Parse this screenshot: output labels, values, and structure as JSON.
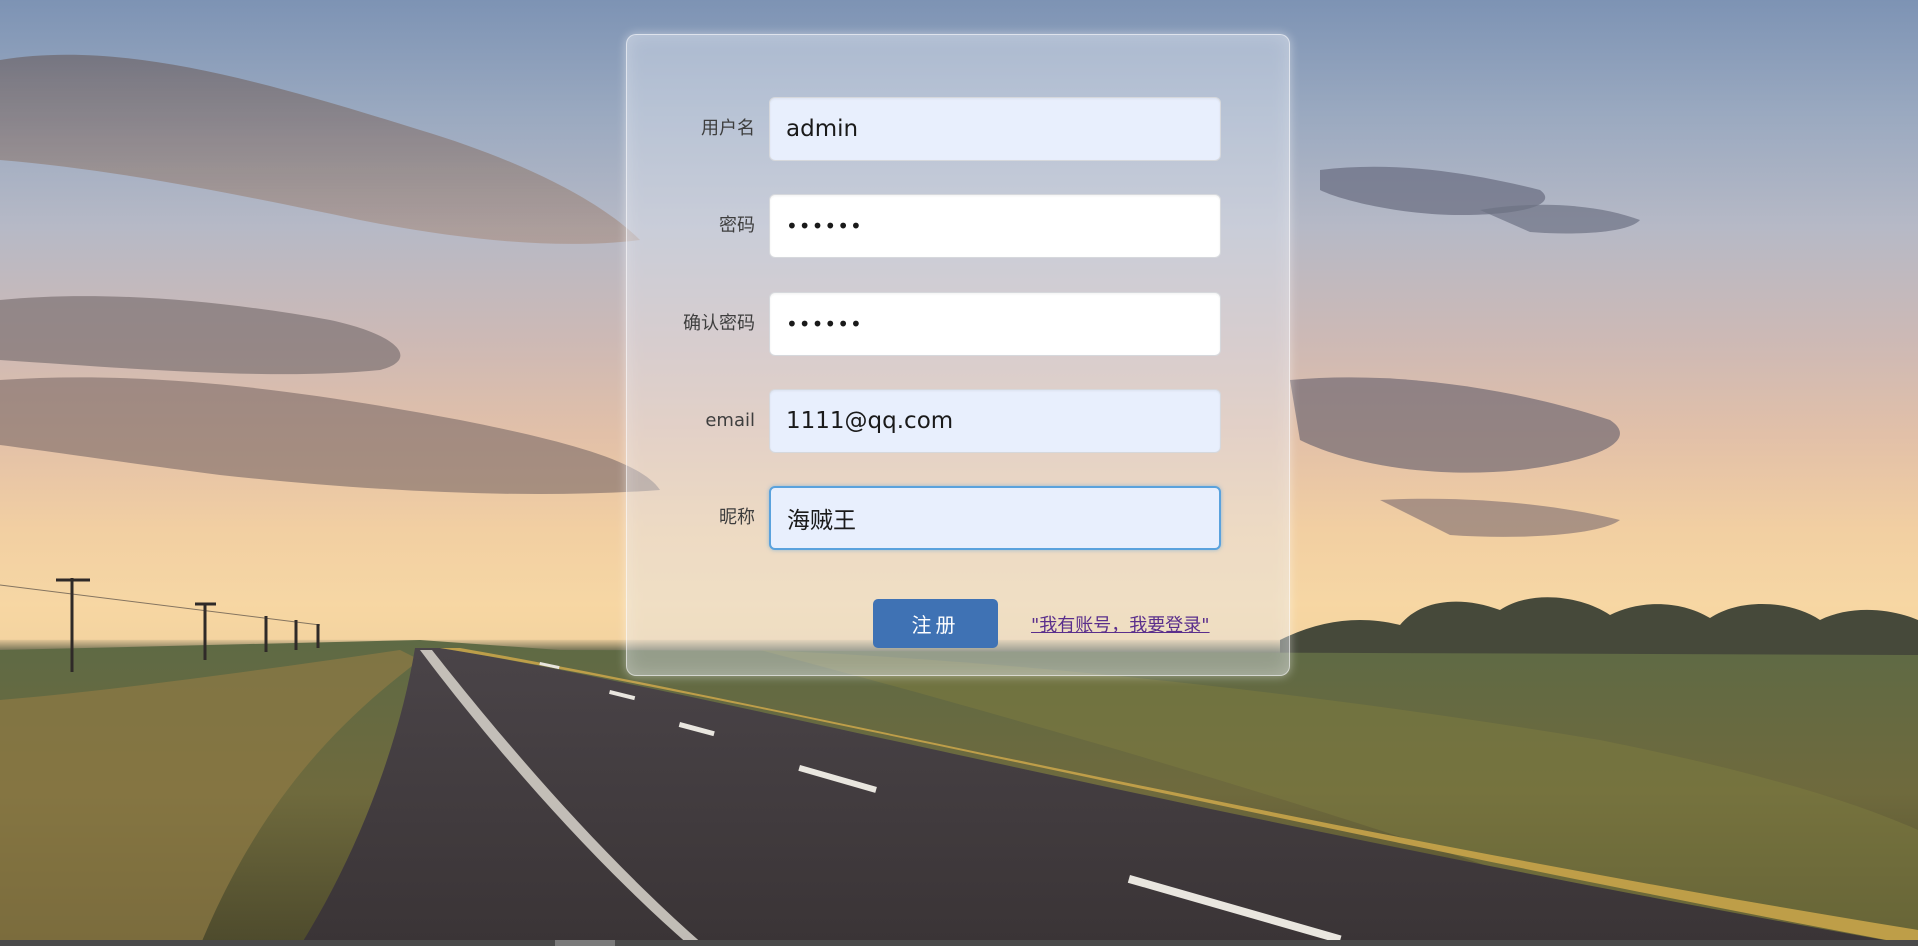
{
  "form": {
    "username": {
      "label": "用户名",
      "value": "admin"
    },
    "password": {
      "label": "密码",
      "value": "••••••"
    },
    "confirm_password": {
      "label": "确认密码",
      "value": "••••••"
    },
    "email": {
      "label": "email",
      "value": "1111@qq.com"
    },
    "nickname": {
      "label": "昵称",
      "value": "海贼王"
    },
    "submit_label": "注册",
    "login_link": "\"我有账号，我要登录\""
  },
  "colors": {
    "button": "#3f72b4",
    "focus_border": "#5aa2dd",
    "autofill_bg": "#e8effd",
    "link": "#5a2e8c"
  }
}
